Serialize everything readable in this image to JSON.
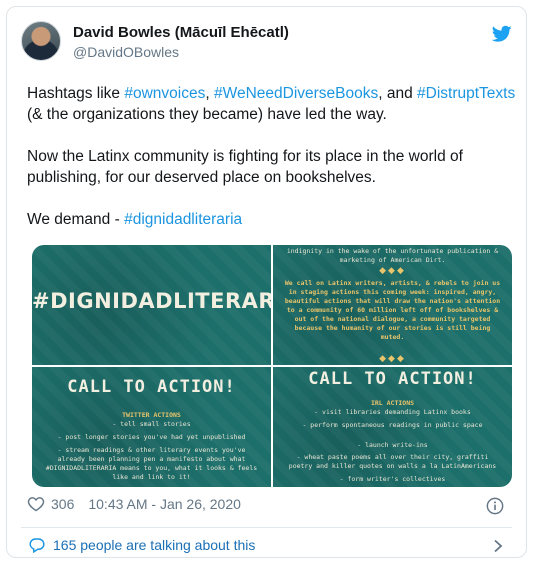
{
  "tweet": {
    "author_name": "David Bowles (Mācuīl Ehēcatl)",
    "handle": "@DavidOBowles",
    "text": {
      "p1_a": "Hashtags like ",
      "tag_ownvoices": "#ownvoices",
      "p1_b": ", ",
      "tag_weneed": "#WeNeedDiverseBooks",
      "p1_c": ", and ",
      "tag_distrupt": "#DistruptTexts",
      "p1_d": " (& the organizations they became) have led the way.",
      "p2": "Now the Latinx community is fighting for its place in the world of publishing, for our deserved place on bookshelves.",
      "p3_a": "We demand - ",
      "tag_dignidad": "#dignidadliteraria"
    },
    "likes": "306",
    "timestamp": "10:43 AM - Jan 26, 2020",
    "talking": "165 people are talking about this"
  },
  "media": {
    "tile1": {
      "hashtag": "#DIGNIDADLITERARIA"
    },
    "tile2": {
      "top": "indignity in the wake of the unfortunate publication & marketing of American Dirt.",
      "body": "We call on Latinx writers, artists, & rebels to join us in staging actions this coming week: inspired, angry, beautiful actions that will draw the nation's attention to a community of 60 million left off of bookshelves & out of the national dialogue, a community targeted because the humanity of our stories is still being muted."
    },
    "tile3": {
      "title": "CALL TO ACTION!",
      "subtitle": "TWITTER ACTIONS",
      "lines": [
        "- tell small stories",
        "- post longer stories you've had yet unpublished",
        "- stream readings & other literary events you've already been planning pen a manifesto about what #DIGNIDADLITERARIA means to you, what it looks & feels like and link to it!"
      ]
    },
    "tile4": {
      "title": "CALL TO ACTION!",
      "subtitle": "IRL ACTIONS",
      "lines": [
        "- visit libraries demanding Latinx books",
        "- perform spontaneous readings in public space",
        "- launch write-ins",
        "- wheat paste poems all over their city, graffiti poetry and killer quotes on walls a la LatinAmericans",
        "- form writer's collectives"
      ]
    }
  },
  "icons": {
    "twitter": "twitter-bird-icon",
    "heart": "heart-icon",
    "info": "info-icon",
    "comment": "comment-icon",
    "chevron": "chevron-right-icon"
  },
  "colors": {
    "accent": "#1b95e0",
    "tile_bg": "#1d6f6b",
    "muted": "#657786"
  }
}
